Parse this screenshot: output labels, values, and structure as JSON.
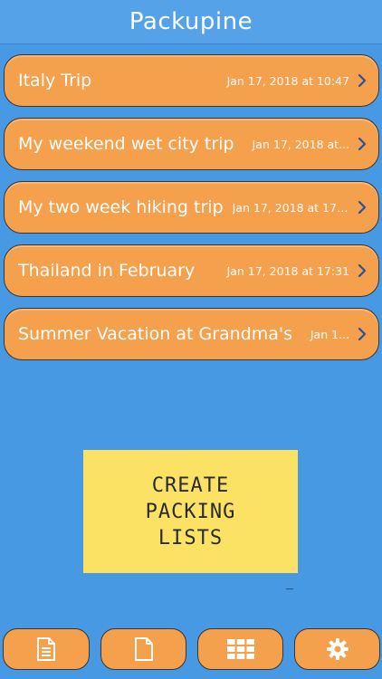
{
  "app": {
    "title": "Packupine"
  },
  "trips": [
    {
      "name": "Italy Trip",
      "date": "Jan 17, 2018 at 10:47"
    },
    {
      "name": "My weekend wet city trip",
      "date": "Jan 17, 2018 at..."
    },
    {
      "name": "My two week hiking trip",
      "date": "Jan 17, 2018 at 17:..."
    },
    {
      "name": "Thailand in February",
      "date": "Jan 17, 2018 at 17:31"
    },
    {
      "name": "Summer Vacation at Grandma's",
      "date": "Jan 1..."
    }
  ],
  "promo": {
    "line1": "CREATE",
    "line2": "PACKING",
    "line3": "LISTS"
  },
  "toolbar": {
    "buttons": [
      {
        "icon": "document-lines-icon"
      },
      {
        "icon": "blank-document-icon"
      },
      {
        "icon": "grid-icon"
      },
      {
        "icon": "gear-icon"
      }
    ]
  },
  "colors": {
    "background": "#4799e3",
    "header": "#55a2e8",
    "row": "#f5a04c",
    "note": "#fbe264",
    "chevron": "#2c4f9a"
  }
}
